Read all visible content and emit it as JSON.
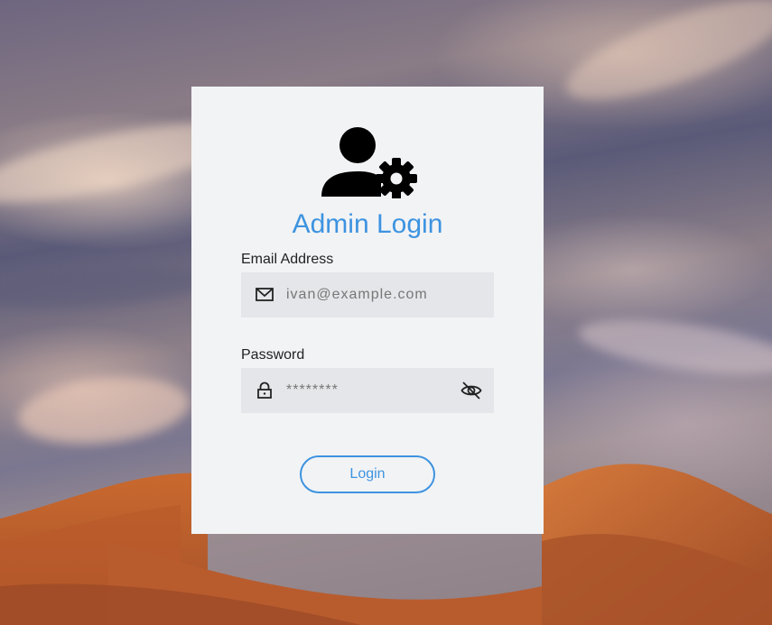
{
  "login_card": {
    "title": "Admin Login",
    "email": {
      "label": "Email Address",
      "placeholder": "ivan@example.com",
      "value": ""
    },
    "password": {
      "label": "Password",
      "placeholder": "********",
      "value": ""
    },
    "submit_label": "Login"
  },
  "icons": {
    "logo": "user-gear-icon",
    "email": "envelope-icon",
    "password": "lock-icon",
    "toggle_visibility": "eye-slash-icon"
  },
  "colors": {
    "accent": "#3d93e0",
    "card_background": "#f2f3f5",
    "field_background": "#e4e6e9",
    "label_text": "#222222"
  }
}
